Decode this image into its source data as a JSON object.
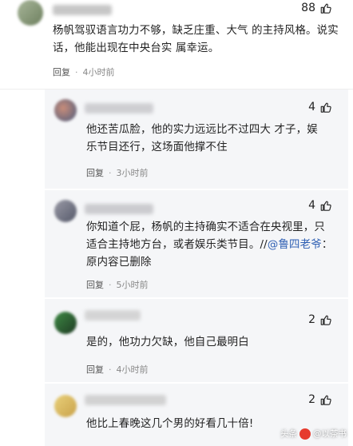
{
  "comments": [
    {
      "id": "c1",
      "likes": "88",
      "text": "杨帆驾驭语言功力不够，缺乏庄重、大气 的主持风格。说实话，他能出现在中央台实 属幸运。",
      "reply_label": "回复",
      "time": "4小时前"
    },
    {
      "id": "r1",
      "likes": "4",
      "text": "他还苦瓜脸，他的实力远远比不过四大 才子，娱乐节目还行，这场面他撑不住",
      "reply_label": "回复",
      "time": "3小时前"
    },
    {
      "id": "r2",
      "likes": "4",
      "text_before": "你知道个屁，杨帆的主持确实不适合在央视里，只适合主持地方台，或者娱乐类节目。//",
      "mention": "@鲁四老爷",
      "text_after": "：原内容已删除",
      "reply_label": "回复",
      "time": "5小时前"
    },
    {
      "id": "r3",
      "likes": "2",
      "text": "是的，他功力欠缺，他自己最明白",
      "reply_label": "回复",
      "time": "4小时前"
    },
    {
      "id": "r4",
      "likes": "2",
      "text": "他比上春晚这几个男的好看几十倍!",
      "reply_label": "",
      "time": ""
    }
  ],
  "icons": {
    "like": "thumbs-up-icon"
  },
  "watermark": {
    "brand": "头条",
    "author": "@以茶书"
  },
  "colors": {
    "mention": "#2e5fb3",
    "reply_bg": "#f5f6f8"
  }
}
